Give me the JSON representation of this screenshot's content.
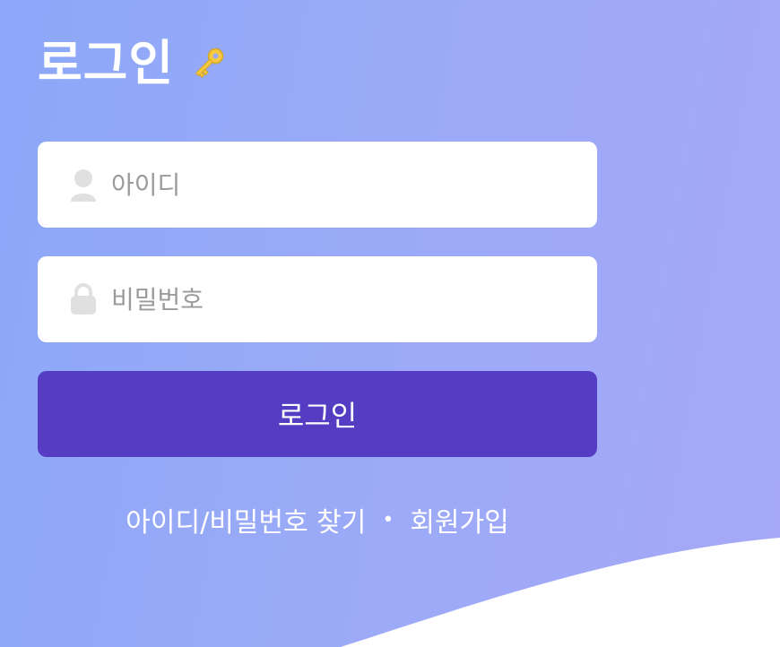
{
  "header": {
    "title": "로그인",
    "title_icon": "key-icon"
  },
  "form": {
    "id_field": {
      "placeholder": "아이디",
      "value": "",
      "icon": "user-icon"
    },
    "password_field": {
      "placeholder": "비밀번호",
      "value": "",
      "icon": "lock-icon"
    },
    "login_button_label": "로그인"
  },
  "links": {
    "find_account": "아이디/비밀번호 찾기",
    "separator": "•",
    "signup": "회원가입"
  },
  "colors": {
    "background_start": "#8ca7f8",
    "background_end": "#a6a8f7",
    "button": "#543dc2",
    "field": "#ffffff",
    "placeholder": "#9a9a9a",
    "icon": "#e0e0e0",
    "key": "#f5c842"
  }
}
